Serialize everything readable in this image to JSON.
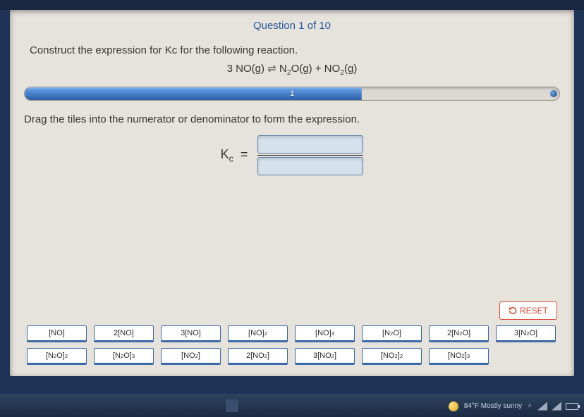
{
  "header": "Question 1 of 10",
  "prompt": "Construct the expression for Kc for the following reaction.",
  "equation": "3 NO(g) ⇌ N₂O(g) + NO₂(g)",
  "progress": {
    "value": "1",
    "percent": 63
  },
  "instruction": "Drag the tiles into the numerator or denominator to form the expression.",
  "kc_label_main": "K",
  "kc_label_sub": "c",
  "kc_equals": "=",
  "reset": "RESET",
  "tiles": {
    "row1": [
      "[NO]",
      "2[NO]",
      "3[NO]",
      "[NO]²",
      "[NO]³",
      "[N₂O]",
      "2[N₂O]",
      "3[N₂O]"
    ],
    "row2": [
      "[N₂O]²",
      "[N₂O]³",
      "[NO₂]",
      "2[NO₂]",
      "3[NO₂]",
      "[NO₂]²",
      "[NO₂]³"
    ]
  },
  "taskbar": {
    "weather": "84°F  Mostly sunny"
  }
}
